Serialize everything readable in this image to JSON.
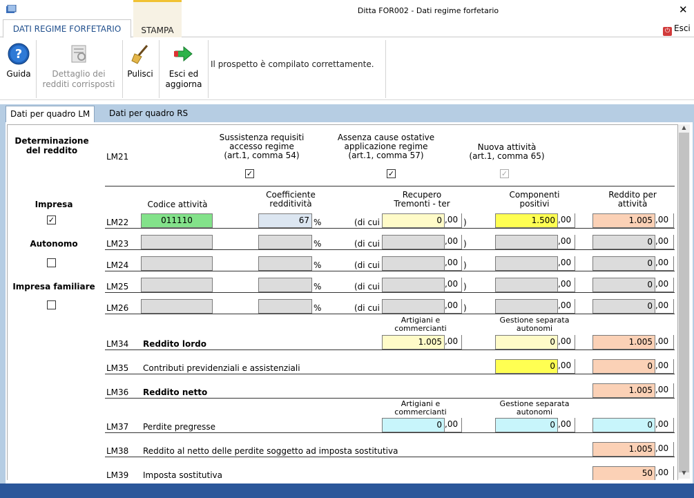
{
  "window": {
    "title": "Ditta FOR002 - Dati regime forfetario",
    "close": "✕"
  },
  "ribbon_tabs": [
    "DATI REGIME FORFETARIO",
    "STAMPA"
  ],
  "exit_top": "Esci",
  "ribbon": {
    "guida": "Guida",
    "dettaglio": [
      "Dettaglio dei",
      "redditi corrisposti"
    ],
    "pulisci": "Pulisci",
    "esci_agg": [
      "Esci ed",
      "aggiorna"
    ],
    "message": "Il prospetto è compilato correttamente."
  },
  "subtabs": [
    "Dati per quadro LM",
    "Dati per quadro RS"
  ],
  "left": {
    "determinazione": [
      "Determinazione",
      "del reddito"
    ],
    "impresa": "Impresa",
    "autonomo": "Autonomo",
    "impresa_familiare": "Impresa familiare",
    "impresa_checked": true
  },
  "lm21": {
    "code": "LM21",
    "h1": [
      "Sussistenza requisiti",
      "accesso regime",
      "(art.1, comma 54)"
    ],
    "h2": [
      "Assenza cause ostative",
      "applicazione regime",
      "(art.1, comma 57)"
    ],
    "h3": [
      "Nuova attività",
      "(art.1, comma 65)"
    ]
  },
  "headers": {
    "codice": "Codice attività",
    "coeff": [
      "Coefficiente",
      "redditività"
    ],
    "recupero": [
      "Recupero",
      "Tremonti - ter"
    ],
    "componenti": [
      "Componenti",
      "positivi"
    ],
    "reddito": [
      "Reddito per",
      "attività"
    ]
  },
  "suffix": {
    "pct": "%",
    "dicui": "(di cui",
    ",00": ",00",
    "paren": ")"
  },
  "rows": [
    {
      "code": "LM22",
      "codice": "011110",
      "coeff": "67",
      "recupero": "0",
      "componenti": "1.500",
      "reddito": "1.005"
    },
    {
      "code": "LM23",
      "codice": "",
      "coeff": "",
      "recupero": "",
      "componenti": "",
      "reddito": "0"
    },
    {
      "code": "LM24",
      "codice": "",
      "coeff": "",
      "recupero": "",
      "componenti": "",
      "reddito": "0"
    },
    {
      "code": "LM25",
      "codice": "",
      "coeff": "",
      "recupero": "",
      "componenti": "",
      "reddito": "0"
    },
    {
      "code": "LM26",
      "codice": "",
      "coeff": "",
      "recupero": "",
      "componenti": "",
      "reddito": "0"
    }
  ],
  "sub_headers": {
    "artigiani": [
      "Artigiani e",
      "commercianti"
    ],
    "gestione": [
      "Gestione separata",
      "autonomi"
    ]
  },
  "lm34": {
    "code": "LM34",
    "label": "Reddito lordo",
    "artigiani": "1.005",
    "gestione": "0",
    "reddito": "1.005"
  },
  "lm35": {
    "code": "LM35",
    "label": "Contributi previdenziali e assistenziali",
    "gestione": "0",
    "reddito": "0"
  },
  "lm36": {
    "code": "LM36",
    "label": "Reddito netto",
    "reddito": "1.005"
  },
  "lm37": {
    "code": "LM37",
    "label": "Perdite pregresse",
    "artigiani": "0",
    "gestione": "0",
    "reddito": "0"
  },
  "lm38": {
    "code": "LM38",
    "label": "Reddito al netto delle perdite soggetto ad imposta sostitutiva",
    "reddito": "1.005"
  },
  "lm39": {
    "code": "LM39",
    "label": "Imposta sostitutiva",
    "reddito": "50"
  }
}
